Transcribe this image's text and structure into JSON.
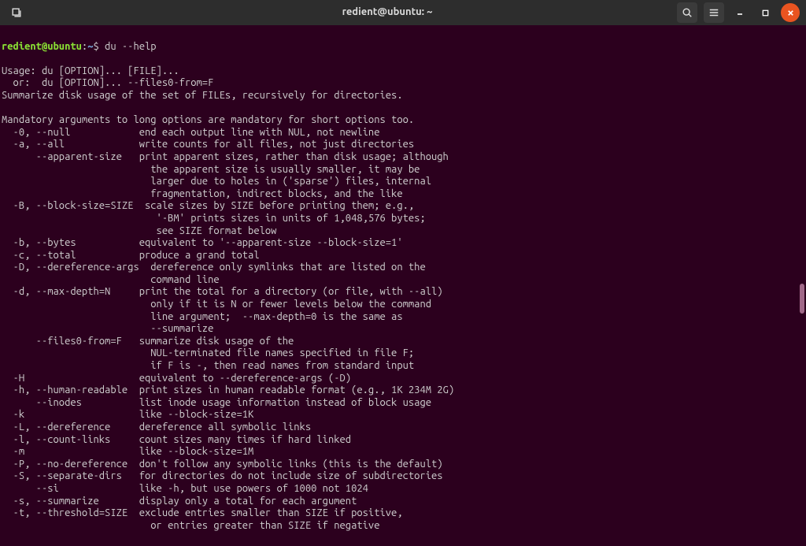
{
  "titlebar": {
    "title": "redient@ubuntu: ~"
  },
  "prompt": {
    "user": "redient@ubuntu",
    "path": "~",
    "symbol": "$"
  },
  "command": "du --help",
  "output": [
    "Usage: du [OPTION]... [FILE]...",
    "  or:  du [OPTION]... --files0-from=F",
    "Summarize disk usage of the set of FILEs, recursively for directories.",
    "",
    "Mandatory arguments to long options are mandatory for short options too.",
    "  -0, --null            end each output line with NUL, not newline",
    "  -a, --all             write counts for all files, not just directories",
    "      --apparent-size   print apparent sizes, rather than disk usage; although",
    "                          the apparent size is usually smaller, it may be",
    "                          larger due to holes in ('sparse') files, internal",
    "                          fragmentation, indirect blocks, and the like",
    "  -B, --block-size=SIZE  scale sizes by SIZE before printing them; e.g.,",
    "                           '-BM' prints sizes in units of 1,048,576 bytes;",
    "                           see SIZE format below",
    "  -b, --bytes           equivalent to '--apparent-size --block-size=1'",
    "  -c, --total           produce a grand total",
    "  -D, --dereference-args  dereference only symlinks that are listed on the",
    "                          command line",
    "  -d, --max-depth=N     print the total for a directory (or file, with --all)",
    "                          only if it is N or fewer levels below the command",
    "                          line argument;  --max-depth=0 is the same as",
    "                          --summarize",
    "      --files0-from=F   summarize disk usage of the",
    "                          NUL-terminated file names specified in file F;",
    "                          if F is -, then read names from standard input",
    "  -H                    equivalent to --dereference-args (-D)",
    "  -h, --human-readable  print sizes in human readable format (e.g., 1K 234M 2G)",
    "      --inodes          list inode usage information instead of block usage",
    "  -k                    like --block-size=1K",
    "  -L, --dereference     dereference all symbolic links",
    "  -l, --count-links     count sizes many times if hard linked",
    "  -m                    like --block-size=1M",
    "  -P, --no-dereference  don't follow any symbolic links (this is the default)",
    "  -S, --separate-dirs   for directories do not include size of subdirectories",
    "      --si              like -h, but use powers of 1000 not 1024",
    "  -s, --summarize       display only a total for each argument",
    "  -t, --threshold=SIZE  exclude entries smaller than SIZE if positive,",
    "                          or entries greater than SIZE if negative"
  ]
}
